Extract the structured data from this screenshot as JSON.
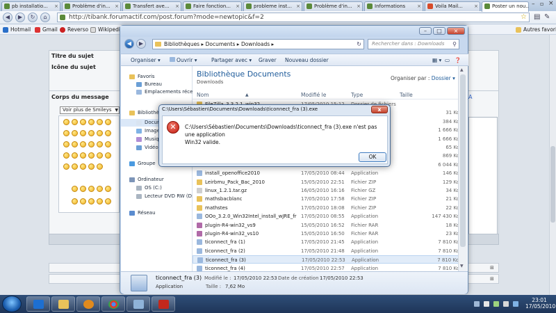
{
  "browser": {
    "tabs": [
      {
        "label": "pb installatio...",
        "icon": "forum-icon"
      },
      {
        "label": "Problème d'in...",
        "icon": "forum-icon"
      },
      {
        "label": "Transfert ave...",
        "icon": "forum-icon"
      },
      {
        "label": "Faire fonction...",
        "icon": "forum-icon"
      },
      {
        "label": "probleme inst...",
        "icon": "forum-icon"
      },
      {
        "label": "Problème d'in...",
        "icon": "forum-icon"
      },
      {
        "label": "Informations",
        "icon": "forum-icon"
      },
      {
        "label": "Voila Mail...",
        "icon": "mail-icon"
      },
      {
        "label": "Poster un nou...",
        "icon": "forum-icon"
      }
    ],
    "url": "http://tibank.forumactif.com/post.forum?mode=newtopic&f=2",
    "bookmarks": [
      "Hotmail",
      "Gmail",
      "Reverso",
      "Wikipedi..."
    ],
    "other_bookmarks": "Autres favoris"
  },
  "forum_page": {
    "subject_label": "Titre du sujet",
    "icon_label": "Icône du sujet",
    "body_label": "Corps du message",
    "smiley_select": "Voir plus de Smileys"
  },
  "explorer": {
    "breadcrumb": [
      "Bibliothèques",
      "Documents",
      "Downloads"
    ],
    "search_placeholder": "Rechercher dans : Downloads",
    "toolbar": [
      "Organiser",
      "Ouvrir",
      "Partager avec",
      "Graver",
      "Nouveau dossier"
    ],
    "nav": [
      {
        "label": "Favoris",
        "icon": "star-icon",
        "indent": 0
      },
      {
        "label": "Bureau",
        "icon": "desktop-icon",
        "indent": 1
      },
      {
        "label": "Emplacements récer",
        "icon": "recent-icon",
        "indent": 1
      },
      {
        "label": "Bibliothè",
        "icon": "library-icon",
        "indent": 0
      },
      {
        "label": "Docum",
        "icon": "documents-icon",
        "indent": 1
      },
      {
        "label": "Image",
        "icon": "pictures-icon",
        "indent": 1
      },
      {
        "label": "Musiq",
        "icon": "music-icon",
        "indent": 1
      },
      {
        "label": "Vidéo",
        "icon": "videos-icon",
        "indent": 1
      },
      {
        "label": "Groupe",
        "icon": "homegroup-icon",
        "indent": 0
      },
      {
        "label": "Ordinateur",
        "icon": "computer-icon",
        "indent": 0
      },
      {
        "label": "OS (C:)",
        "icon": "drive-icon",
        "indent": 1
      },
      {
        "label": "Lecteur DVD RW (D:)",
        "icon": "dvd-icon",
        "indent": 1
      },
      {
        "label": "Réseau",
        "icon": "network-icon",
        "indent": 0
      }
    ],
    "library_title": "Bibliothèque Documents",
    "library_subtitle": "Downloads",
    "arrange_label": "Organiser par :",
    "arrange_value": "Dossier",
    "columns": [
      "Nom",
      "Modifié le",
      "Type",
      "Taille"
    ],
    "files": [
      {
        "name": "FileZilla_3.3.2.1_win32...",
        "date": "17/05/2010 15:12",
        "type": "Dossier de fichiers",
        "size": ""
      },
      {
        "name": "",
        "date": "",
        "type": "",
        "size": "31 Ko"
      },
      {
        "name": "",
        "date": "",
        "type": "",
        "size": "384 Ko"
      },
      {
        "name": "",
        "date": "",
        "type": "",
        "size": "1 666 Ko"
      },
      {
        "name": "",
        "date": "",
        "type": "",
        "size": "1 666 Ko"
      },
      {
        "name": "",
        "date": "",
        "type": "",
        "size": "65 Ko"
      },
      {
        "name": "",
        "date": "",
        "type": "",
        "size": "869 Ko"
      },
      {
        "name": "",
        "date": "",
        "type": "",
        "size": "6 044 Ko"
      },
      {
        "name": "install_openoffice2010",
        "date": "17/05/2010 08:44",
        "type": "Application",
        "size": "146 Ko"
      },
      {
        "name": "Leirbmu_Pack_Bac_2010",
        "date": "15/05/2010 22:51",
        "type": "Fichier ZIP",
        "size": "129 Ko"
      },
      {
        "name": "linux_1.2.1.tar.gz",
        "date": "16/05/2010 16:16",
        "type": "Fichier GZ",
        "size": "34 Ko"
      },
      {
        "name": "mathsbacblanc",
        "date": "17/05/2010 17:58",
        "type": "Fichier ZIP",
        "size": "21 Ko"
      },
      {
        "name": "mathstes",
        "date": "17/05/2010 18:08",
        "type": "Fichier ZIP",
        "size": "22 Ko"
      },
      {
        "name": "OOo_3.2.0_Win32Intel_install_wJRE_fr",
        "date": "17/05/2010 08:55",
        "type": "Application",
        "size": "147 430 Ko"
      },
      {
        "name": "plugin-R4-win32_vs9",
        "date": "15/05/2010 16:52",
        "type": "Fichier RAR",
        "size": "18 Ko"
      },
      {
        "name": "plugin-R4-win32_vs10",
        "date": "15/05/2010 16:50",
        "type": "Fichier RAR",
        "size": "23 Ko"
      },
      {
        "name": "ticonnect_fra (1)",
        "date": "17/05/2010 21:45",
        "type": "Application",
        "size": "7 810 Ko"
      },
      {
        "name": "ticonnect_fra (2)",
        "date": "17/05/2010 21:48",
        "type": "Application",
        "size": "7 810 Ko"
      },
      {
        "name": "ticonnect_fra (3)",
        "date": "17/05/2010 22:53",
        "type": "Application",
        "size": "7 810 Ko",
        "selected": true
      },
      {
        "name": "ticonnect_fra (4)",
        "date": "17/05/2010 22:57",
        "type": "Application",
        "size": "7 810 Ko"
      }
    ],
    "details": {
      "name": "ticonnect_fra (3)",
      "type": "Application",
      "modified_label": "Modifié le :",
      "modified": "17/05/2010 22:53",
      "size_label": "Taille :",
      "size": "7,62 Mo",
      "created_label": "Date de création :",
      "created": "17/05/2010 22:53"
    }
  },
  "dialog": {
    "title": "C:\\Users\\Sébastien\\Documents\\Downloads\\ticonnect_fra (3).exe",
    "message_line1": "C:\\Users\\Sébastien\\Documents\\Downloads\\ticonnect_fra (3).exe n'est pas une application",
    "message_line2": "Win32 valide.",
    "ok_label": "OK",
    "close_label": "x"
  },
  "taskbar": {
    "clock_time": "23:01",
    "clock_date": "17/05/2010",
    "apps": [
      "explorer-icon",
      "media-player-icon",
      "chrome-icon",
      "control-panel-icon",
      "error-app-icon"
    ]
  },
  "colors": {
    "accent": "#1e5b9a",
    "error": "#c21a10",
    "taskbar": "#1e3558"
  }
}
